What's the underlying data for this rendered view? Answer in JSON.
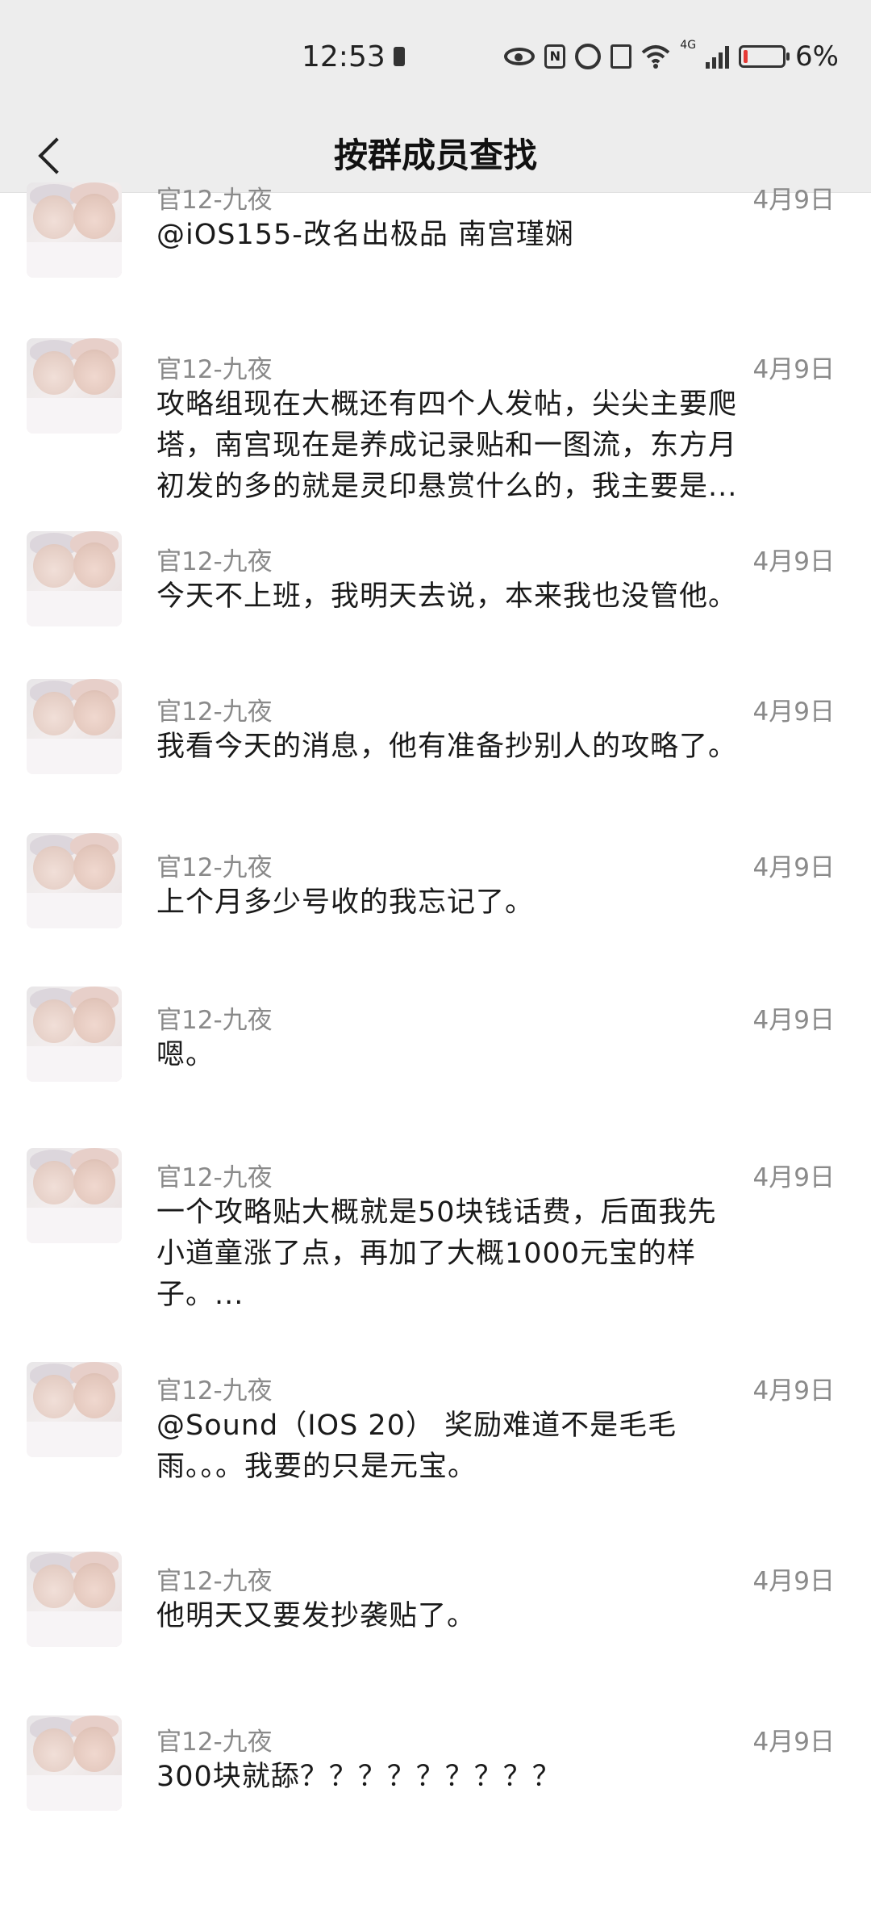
{
  "status_bar": {
    "time": "12:53",
    "network_label": "4G",
    "battery_percent": "6%",
    "icons": [
      "eye-icon",
      "nfc-icon",
      "alarm-icon",
      "vibrate-icon",
      "wifi-icon",
      "signal-icon",
      "battery-icon"
    ]
  },
  "header": {
    "back_icon": "chevron-left-icon",
    "title": "按群成员查找"
  },
  "messages": [
    {
      "sender": "官12-九夜",
      "date": "4月9日",
      "lines": [
        "@iOS155-改名出极品 南宫瑾娴"
      ]
    },
    {
      "sender": "官12-九夜",
      "date": "4月9日",
      "lines": [
        "攻略组现在大概还有四个人发帖，尖尖主要爬",
        "塔，南宫现在是养成记录贴和一图流，东方月",
        "初发的多的就是灵印悬赏什么的，我主要是..."
      ]
    },
    {
      "sender": "官12-九夜",
      "date": "4月9日",
      "lines": [
        "今天不上班，我明天去说，本来我也没管他。"
      ]
    },
    {
      "sender": "官12-九夜",
      "date": "4月9日",
      "lines": [
        "我看今天的消息，他有准备抄别人的攻略了。"
      ]
    },
    {
      "sender": "官12-九夜",
      "date": "4月9日",
      "lines": [
        "上个月多少号收的我忘记了。"
      ]
    },
    {
      "sender": "官12-九夜",
      "date": "4月9日",
      "lines": [
        "嗯。"
      ]
    },
    {
      "sender": "官12-九夜",
      "date": "4月9日",
      "lines": [
        "一个攻略贴大概就是50块钱话费，后面我先",
        "小道童涨了点，再加了大概1000元宝的样",
        "子。..."
      ]
    },
    {
      "sender": "官12-九夜",
      "date": "4月9日",
      "lines": [
        "@Sound（IOS 20） 奖励难道不是毛毛",
        "雨。。。我要的只是元宝。"
      ]
    },
    {
      "sender": "官12-九夜",
      "date": "4月9日",
      "lines": [
        "他明天又要发抄袭贴了。"
      ]
    },
    {
      "sender": "官12-九夜",
      "date": "4月9日",
      "lines": [
        "300块就舔？？？？？？？？？"
      ]
    }
  ]
}
